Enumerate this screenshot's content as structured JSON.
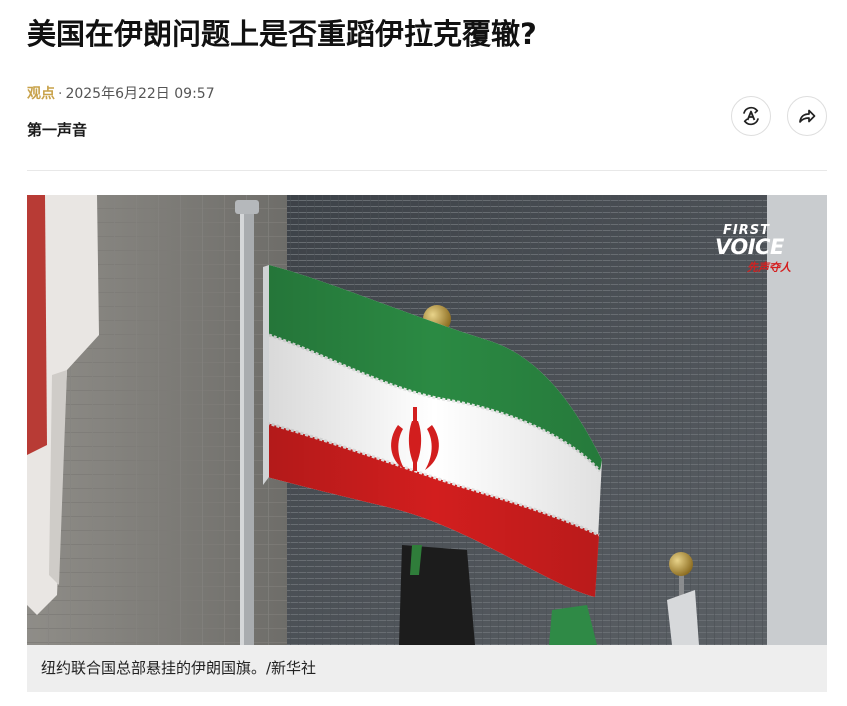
{
  "article": {
    "headline": "美国在伊朗问题上是否重蹈伊拉克覆辙?",
    "category": "观点",
    "separator": "·",
    "date": "2025年6月22日 09:57",
    "author": "第一声音"
  },
  "actions": {
    "translate_icon": "translate-icon",
    "share_icon": "share-icon"
  },
  "figure": {
    "caption": "纽约联合国总部悬挂的伊朗国旗。/新华社",
    "watermark": {
      "line1": "FIRST",
      "line2": "VOICE",
      "line3": "先声夺人"
    }
  },
  "colors": {
    "category": "#c8a24a",
    "caption_background": "#eeeeee",
    "flag_green": "#239f40",
    "flag_white": "#ffffff",
    "flag_red": "#da0000"
  }
}
